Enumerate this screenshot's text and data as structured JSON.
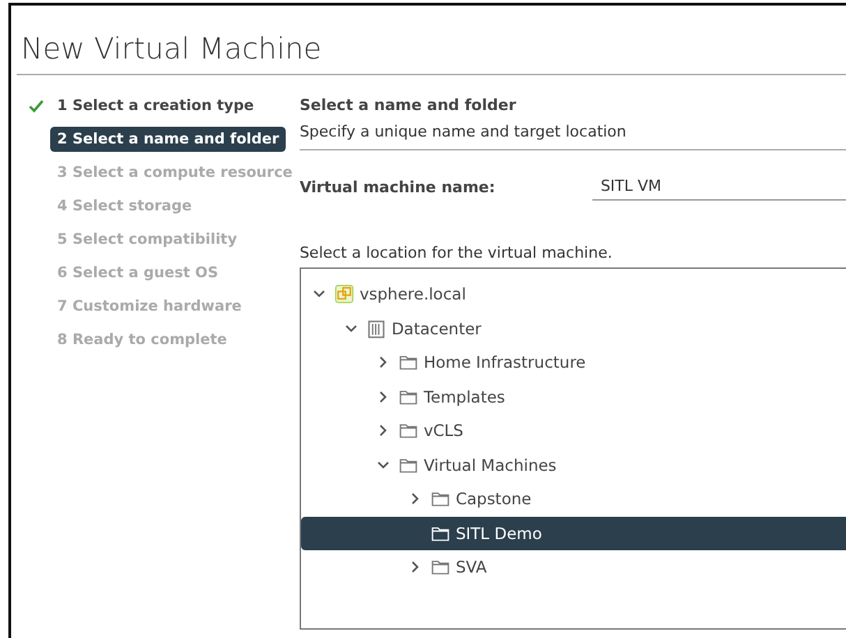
{
  "window": {
    "title": "New Virtual Machine"
  },
  "steps": [
    {
      "label": "1 Select a creation type",
      "selected": false,
      "completed": true,
      "disabled": false
    },
    {
      "label": "2 Select a name and folder",
      "selected": true,
      "completed": false,
      "disabled": false
    },
    {
      "label": "3 Select a compute resource",
      "selected": false,
      "completed": false,
      "disabled": true
    },
    {
      "label": "4 Select storage",
      "selected": false,
      "completed": false,
      "disabled": true
    },
    {
      "label": "5 Select compatibility",
      "selected": false,
      "completed": false,
      "disabled": true
    },
    {
      "label": "6 Select a guest OS",
      "selected": false,
      "completed": false,
      "disabled": true
    },
    {
      "label": "7 Customize hardware",
      "selected": false,
      "completed": false,
      "disabled": true
    },
    {
      "label": "8 Ready to complete",
      "selected": false,
      "completed": false,
      "disabled": true
    }
  ],
  "section": {
    "heading": "Select a name and folder",
    "description": "Specify a unique name and target location"
  },
  "name_field": {
    "label": "Virtual machine name:",
    "value": "SITL VM"
  },
  "location": {
    "prompt": "Select a location for the virtual machine.",
    "tree": [
      {
        "label": "vsphere.local",
        "kind": "domain",
        "expanded": true,
        "selected": false,
        "children": [
          {
            "label": "Datacenter",
            "kind": "datacenter",
            "expanded": true,
            "selected": false,
            "children": [
              {
                "label": "Home Infrastructure",
                "kind": "folder",
                "expanded": false,
                "selected": false
              },
              {
                "label": "Templates",
                "kind": "folder",
                "expanded": false,
                "selected": false
              },
              {
                "label": "vCLS",
                "kind": "folder",
                "expanded": false,
                "selected": false
              },
              {
                "label": "Virtual Machines",
                "kind": "folder",
                "expanded": true,
                "selected": false,
                "children": [
                  {
                    "label": "Capstone",
                    "kind": "folder",
                    "expanded": false,
                    "selected": false
                  },
                  {
                    "label": "SITL Demo",
                    "kind": "folder",
                    "selected": true
                  },
                  {
                    "label": "SVA",
                    "kind": "folder",
                    "expanded": false,
                    "selected": false
                  }
                ]
              }
            ]
          }
        ]
      }
    ]
  }
}
